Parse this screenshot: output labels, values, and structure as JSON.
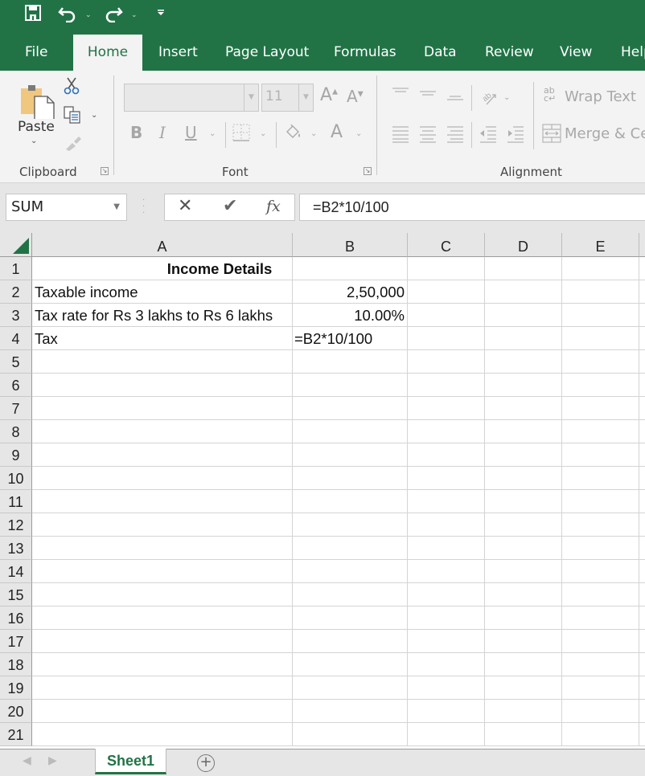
{
  "qat": {
    "icons": [
      "save-icon",
      "undo-icon",
      "redo-icon",
      "customize-qat-icon"
    ]
  },
  "tabs": [
    {
      "label": "File",
      "active": false
    },
    {
      "label": "Home",
      "active": true
    },
    {
      "label": "Insert",
      "active": false
    },
    {
      "label": "Page Layout",
      "active": false
    },
    {
      "label": "Formulas",
      "active": false
    },
    {
      "label": "Data",
      "active": false
    },
    {
      "label": "Review",
      "active": false
    },
    {
      "label": "View",
      "active": false
    },
    {
      "label": "Help",
      "active": false
    }
  ],
  "ribbon": {
    "clipboard": {
      "label": "Clipboard",
      "paste_label": "Paste"
    },
    "font": {
      "label": "Font",
      "font_name": "",
      "font_size": "11",
      "bold": "B",
      "italic": "I",
      "underline": "U",
      "font_color": "A",
      "grow": "A",
      "shrink": "A"
    },
    "alignment": {
      "label": "Alignment",
      "wrap_text": "Wrap Text",
      "merge_center": "Merge & Center"
    }
  },
  "formula_bar": {
    "name_box": "SUM",
    "cancel": "✕",
    "enter": "✔",
    "fx": "fx",
    "formula": "=B2*10/100"
  },
  "grid": {
    "columns": [
      "A",
      "B",
      "C",
      "D",
      "E"
    ],
    "rows": [
      "1",
      "2",
      "3",
      "4",
      "5",
      "6",
      "7",
      "8",
      "9",
      "10",
      "11",
      "12",
      "13",
      "14",
      "15",
      "16",
      "17",
      "18",
      "19",
      "20",
      "21"
    ],
    "cells": {
      "A1": "Income Details",
      "A2": "Taxable income",
      "B2": "2,50,000",
      "A3": "Tax rate for Rs 3 lakhs to Rs 6 lakhs",
      "B3": "10.00%",
      "A4": "Tax",
      "B4": "=B2*10/100"
    }
  },
  "sheets": {
    "tabs": [
      "Sheet1"
    ],
    "active": "Sheet1",
    "prev": "◀",
    "next": "▶",
    "add": "+"
  },
  "colors": {
    "accent": "#217346",
    "ribbon_bg": "#f3f3f3",
    "chrome_bg": "#e6e6e6"
  }
}
